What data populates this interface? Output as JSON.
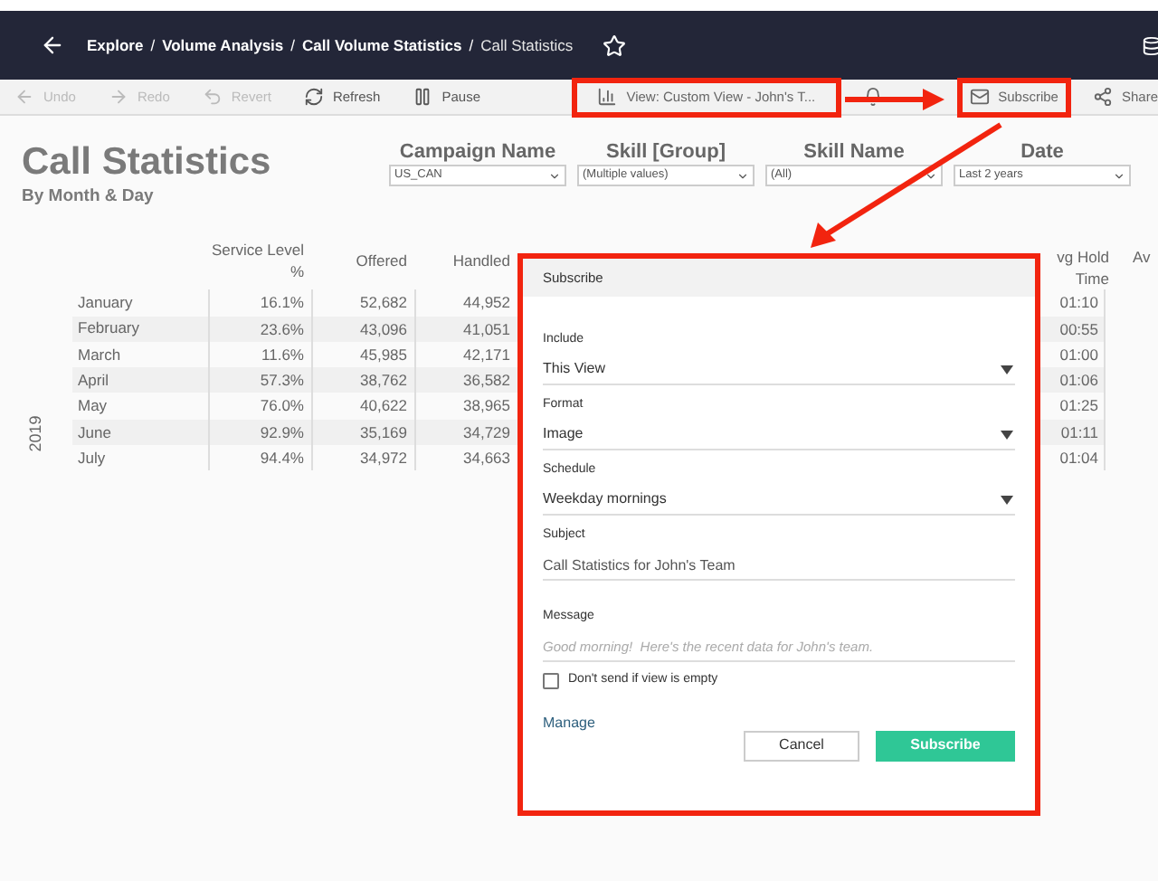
{
  "breadcrumb_separator": "/",
  "breadcrumb": [
    {
      "label": "Explore",
      "kind": "link"
    },
    {
      "label": "Volume Analysis",
      "kind": "link"
    },
    {
      "label": "Call Volume Statistics",
      "kind": "link"
    },
    {
      "label": "Call Statistics",
      "kind": "current"
    }
  ],
  "toolbar": [
    {
      "label": "Undo",
      "kind": "undo",
      "disabled": true
    },
    {
      "label": "Redo",
      "kind": "redo",
      "disabled": true
    },
    {
      "label": "Revert",
      "kind": "revert",
      "disabled": true
    },
    {
      "label": "Refresh",
      "kind": "refresh",
      "disabled": false
    },
    {
      "label": "Pause",
      "kind": "pause",
      "disabled": false
    }
  ],
  "toolbar_right": [
    {
      "label": "View: Custom View - John's T...",
      "kind": "view",
      "highlighted": true
    },
    {
      "kind": "alert",
      "highlighted": false
    },
    {
      "label": "Subscribe",
      "kind": "subscribe",
      "highlighted": true
    },
    {
      "label": "Share",
      "kind": "share",
      "highlighted": false
    }
  ],
  "title": "Call Statistics",
  "subtitle": "By Month & Day",
  "filters": [
    {
      "title": "Campaign Name",
      "value": "US_CAN"
    },
    {
      "title": "Skill [Group]",
      "value": "(Multiple values)"
    },
    {
      "title": "Skill Name",
      "value": "(All)"
    },
    {
      "title": "Date",
      "value": "Last 2 years"
    }
  ],
  "table": {
    "columns": [
      "Service Level %",
      "Offered",
      "Handled"
    ],
    "right_column": "vg Hold Time",
    "far_column": "Av",
    "year": "2019",
    "rows": [
      {
        "month": "January",
        "values": [
          "16.1%",
          "52,682",
          "44,952"
        ],
        "hold": "01:10"
      },
      {
        "month": "February",
        "values": [
          "23.6%",
          "43,096",
          "41,051"
        ],
        "hold": "00:55"
      },
      {
        "month": "March",
        "values": [
          "11.6%",
          "45,985",
          "42,171"
        ],
        "hold": "01:00"
      },
      {
        "month": "April",
        "values": [
          "57.3%",
          "38,762",
          "36,582"
        ],
        "hold": "01:06"
      },
      {
        "month": "May",
        "values": [
          "76.0%",
          "40,622",
          "38,965"
        ],
        "hold": "01:25"
      },
      {
        "month": "June",
        "values": [
          "92.9%",
          "35,169",
          "34,729"
        ],
        "hold": "01:11"
      },
      {
        "month": "July",
        "values": [
          "94.4%",
          "34,972",
          "34,663"
        ],
        "hold": "01:04"
      }
    ]
  },
  "dialog": {
    "title": "Subscribe",
    "fields": [
      {
        "label": "Include",
        "value": "This View",
        "kind": "select"
      },
      {
        "label": "Format",
        "value": "Image",
        "kind": "select"
      },
      {
        "label": "Schedule",
        "value": "Weekday mornings",
        "kind": "select"
      },
      {
        "label": "Subject",
        "value": "Call Statistics for John's Team",
        "kind": "text"
      },
      {
        "label": "Message",
        "placeholder": "Good morning!  Here's the recent data for John's team.",
        "kind": "textarea"
      }
    ],
    "checkbox": {
      "label": "Don't send if view is empty",
      "checked": false
    },
    "manage": "Manage",
    "cancel": "Cancel",
    "submit": "Subscribe"
  }
}
